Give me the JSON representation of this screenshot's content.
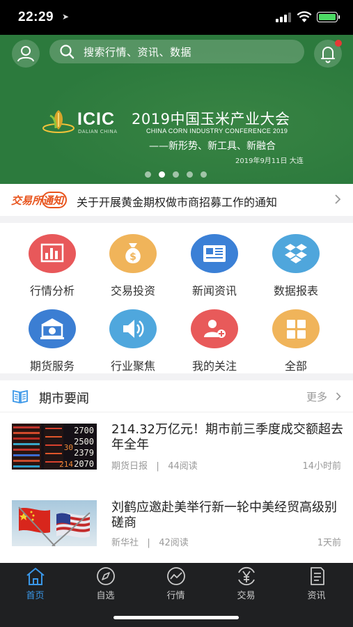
{
  "status": {
    "time": "22:29",
    "location_icon": "location-arrow-icon",
    "signal_icon": "cellular-signal-icon",
    "wifi_icon": "wifi-icon",
    "battery_icon": "battery-charging-icon"
  },
  "header": {
    "avatar_icon": "user-icon",
    "search_placeholder": "搜索行情、资讯、数据",
    "bell_icon": "bell-icon",
    "has_notification": true
  },
  "banner": {
    "logo_text": "ICIC",
    "logo_sub": "DALIAN CHINA",
    "title": "2019中国玉米产业大会",
    "subtitle_en": "CHINA CORN INDUSTRY CONFERENCE 2019",
    "slogan": "——新形势、新工具、新融合",
    "date": "2019年9月11日 大连",
    "dots": 5,
    "active_dot": 1
  },
  "notice": {
    "logo_text": "交易所通知",
    "text": "关于开展黄金期权做市商招募工作的通知"
  },
  "grid": [
    {
      "label": "行情分析",
      "icon": "bar-chart-icon",
      "color": "#e8585a"
    },
    {
      "label": "交易投资",
      "icon": "money-bag-icon",
      "color": "#f0b45a"
    },
    {
      "label": "新闻资讯",
      "icon": "newspaper-icon",
      "color": "#3b80d6"
    },
    {
      "label": "数据报表",
      "icon": "dropbox-icon",
      "color": "#4fa6dc"
    },
    {
      "label": "期货服务",
      "icon": "bank-icon",
      "color": "#3b7ed3"
    },
    {
      "label": "行业聚焦",
      "icon": "speaker-icon",
      "color": "#4fa7dd"
    },
    {
      "label": "我的关注",
      "icon": "add-user-icon",
      "color": "#e85a5a"
    },
    {
      "label": "全部",
      "icon": "grid-icon",
      "color": "#f0b45a"
    }
  ],
  "news": {
    "title": "期市要闻",
    "more": "更多",
    "articles": [
      {
        "title": "214.32万亿元！期市前三季度成交额超去年全年",
        "source": "期货日报",
        "sep": "|",
        "reads": "44阅读",
        "time": "14小时前"
      },
      {
        "title": "刘鹤应邀赴美举行新一轮中美经贸高级别磋商",
        "source": "新华社",
        "sep": "|",
        "reads": "42阅读",
        "time": "1天前"
      }
    ]
  },
  "ticker": [
    "2700",
    "2500",
    "2379",
    "30",
    "2070",
    "214"
  ],
  "tabbar": [
    {
      "label": "首页",
      "icon": "home-icon",
      "active": true
    },
    {
      "label": "自选",
      "icon": "compass-icon",
      "active": false
    },
    {
      "label": "行情",
      "icon": "trend-icon",
      "active": false
    },
    {
      "label": "交易",
      "icon": "yen-icon",
      "active": false
    },
    {
      "label": "资讯",
      "icon": "document-icon",
      "active": false
    }
  ],
  "colors": {
    "header_green": "#2c7a3d",
    "accent_blue": "#3a97e8",
    "notice_orange": "#e8541d",
    "tabbar_bg": "#1f2022"
  }
}
